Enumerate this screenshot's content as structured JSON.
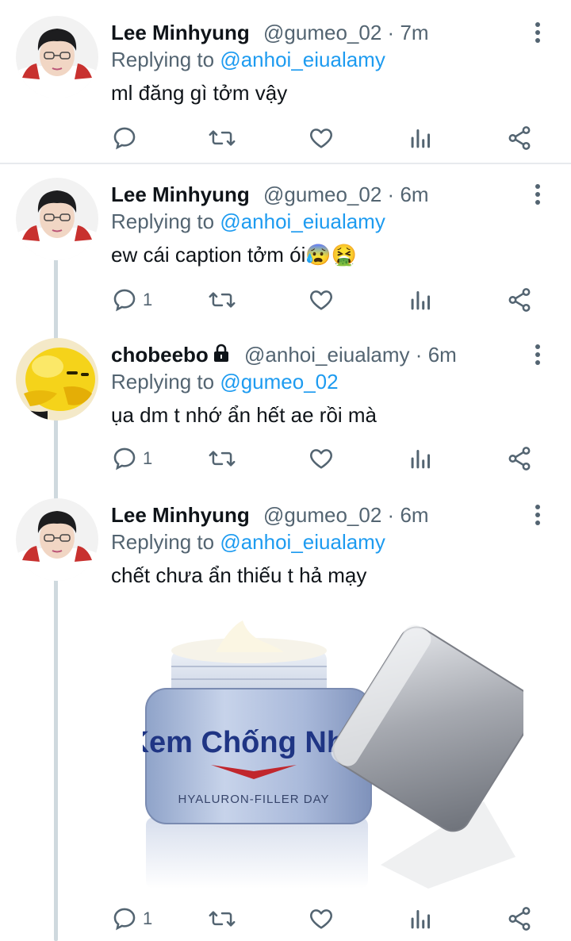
{
  "tweets": [
    {
      "name": "Lee Minhyung",
      "handle": "@gumeo_02",
      "dot": "·",
      "time": "7m",
      "replying_prefix": "Replying to",
      "replying_to": "@anhoi_eiualamy",
      "text": "ml đăng gì tởm vậy",
      "reply_count": ""
    },
    {
      "name": "Lee Minhyung",
      "handle": "@gumeo_02",
      "dot": "·",
      "time": "6m",
      "replying_prefix": "Replying to",
      "replying_to": "@anhoi_eiualamy",
      "text": "ew cái caption tởm ói😰🤮",
      "reply_count": "1"
    },
    {
      "name": "chobeebo",
      "handle": "@anhoi_eiualamy",
      "dot": "·",
      "time": "6m",
      "replying_prefix": "Replying to",
      "replying_to": "@gumeo_02",
      "text": "ụa dm t nhớ ẩn hết ae rồi mà",
      "reply_count": "1",
      "protected": true
    },
    {
      "name": "Lee Minhyung",
      "handle": "@gumeo_02",
      "dot": "·",
      "time": "6m",
      "replying_prefix": "Replying to",
      "replying_to": "@anhoi_eiualamy",
      "text": "chết chưa ẩn thiếu t hả mạy",
      "reply_count": "1",
      "media": {
        "product_name": "Kem Chống Nhục",
        "product_sub": "HYALURON-FILLER DAY"
      }
    }
  ],
  "icons": {
    "reply": "reply-icon",
    "retweet": "retweet-icon",
    "like": "heart-icon",
    "views": "analytics-icon",
    "share": "share-icon",
    "more": "more-vertical-icon",
    "lock": "lock-icon"
  },
  "colors": {
    "text": "#0f1419",
    "secondary": "#536471",
    "accent": "#1d9bf0",
    "divider": "#e7eaee",
    "thread_line": "#cfd9de"
  }
}
